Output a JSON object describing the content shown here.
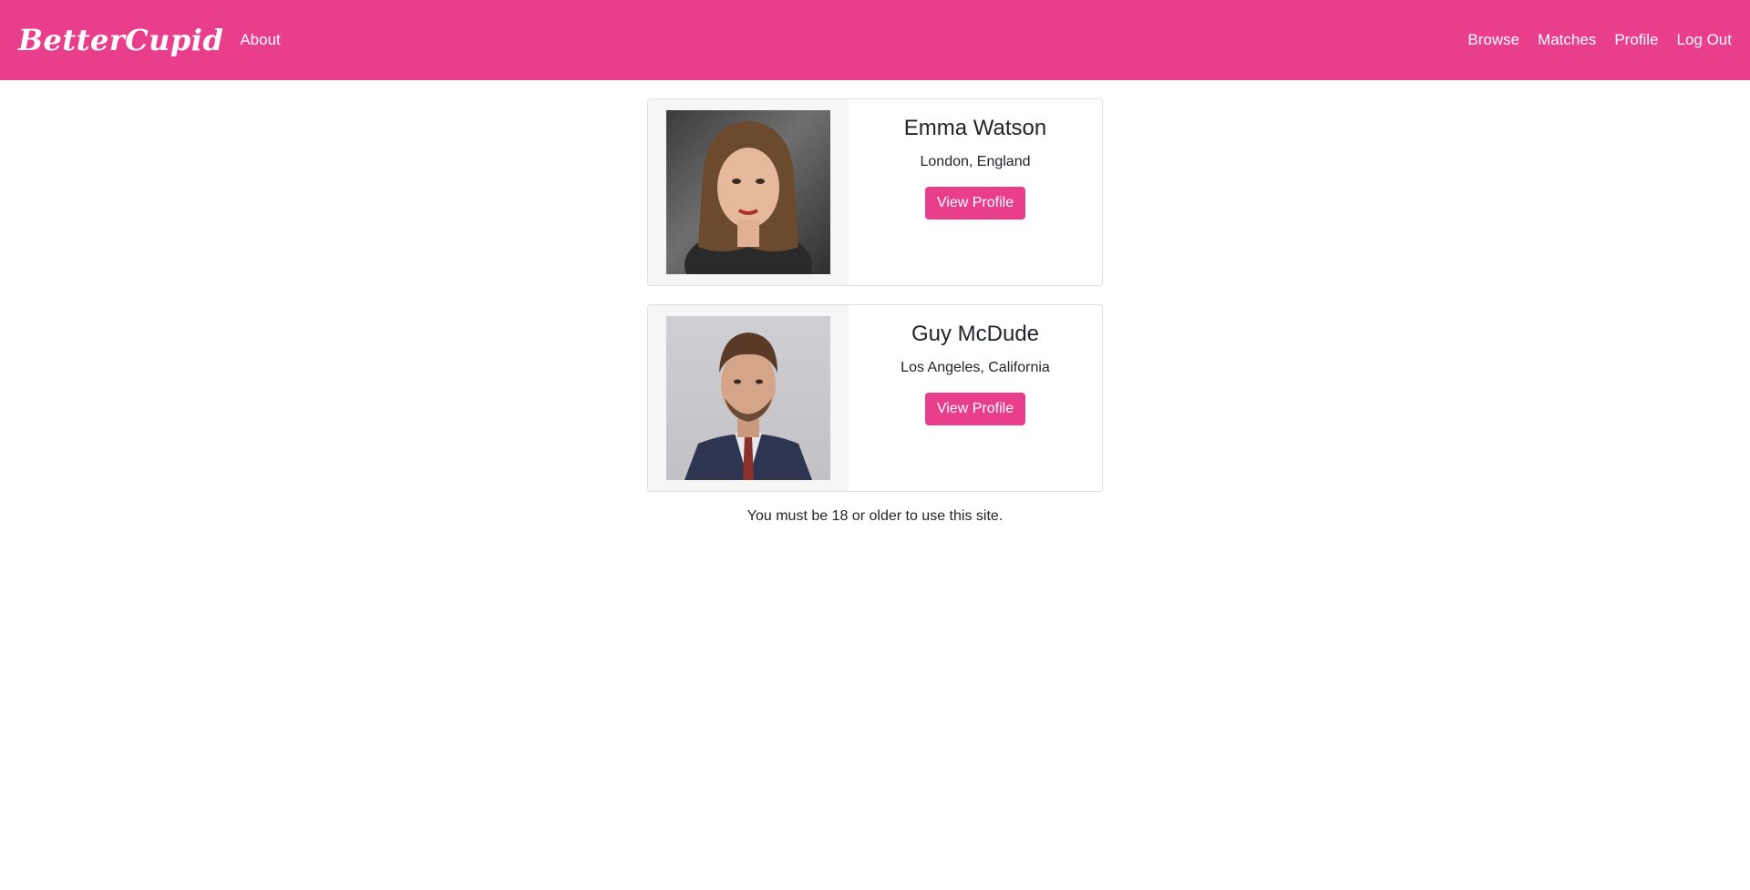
{
  "nav": {
    "brand": "BetterCupid",
    "about": "About",
    "links": [
      "Browse",
      "Matches",
      "Profile",
      "Log Out"
    ],
    "bg_color": "#e83e8c"
  },
  "profiles": [
    {
      "name": "Emma Watson",
      "location": "London, England",
      "button": "View Profile"
    },
    {
      "name": "Guy McDude",
      "location": "Los Angeles, California",
      "button": "View Profile"
    }
  ],
  "footer": {
    "note": "You must be 18 or older to use this site."
  }
}
